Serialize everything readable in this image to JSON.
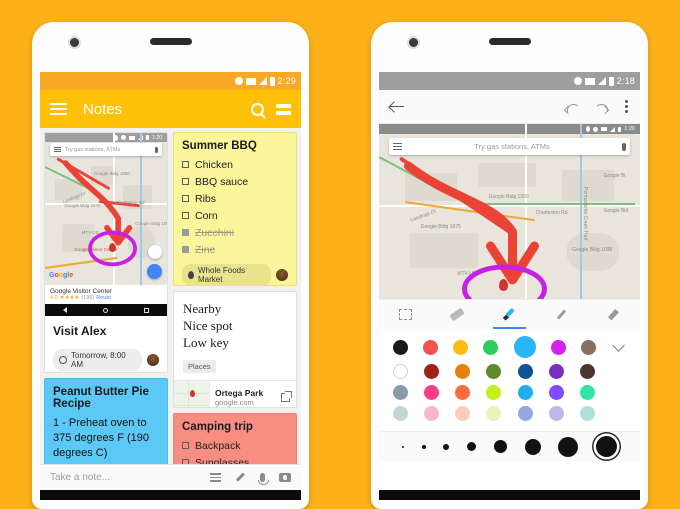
{
  "background_color": "#FBB117",
  "left_phone": {
    "status_bar": {
      "time": "2:29",
      "icons": [
        "alarm-icon",
        "wifi-icon",
        "signal-icon",
        "battery-icon"
      ],
      "background": "#F9A825"
    },
    "app_bar": {
      "title": "Notes",
      "menu_icon": "hamburger-icon",
      "search_icon": "search-icon",
      "view_toggle_icon": "list-view-icon",
      "background": "#FFC107"
    },
    "notes": {
      "map_note": {
        "search_placeholder": "Try gas stations, ATMs",
        "map_labels": [
          "Google Bldg 1950",
          "Google Bldg 1875",
          "Charleston Rd",
          "Landings Dr",
          "Google Bldg 1098",
          "MTV-US",
          "Google Visitor Center",
          "Permanente Creek Trail"
        ],
        "logo_text": "Google",
        "place_card": {
          "name": "Google Visitor Center",
          "rating": "4.0",
          "reviews": "(195)",
          "action": "Route"
        }
      },
      "visit_note": {
        "title": "Visit Alex",
        "reminder": "Tomorrow, 8:00 AM",
        "clock_icon": "clock-icon",
        "avatar": "user-avatar"
      },
      "recipe_note": {
        "title": "Peanut Butter Pie Recipe",
        "body": "1 - Preheat oven to 375 degrees F (190 degrees C)",
        "color": "#5CC8F5"
      },
      "bbq_note": {
        "title": "Summer BBQ",
        "color": "#FBF59B",
        "items": [
          {
            "label": "Chicken",
            "checked": false
          },
          {
            "label": "BBQ sauce",
            "checked": false
          },
          {
            "label": "Ribs",
            "checked": false
          },
          {
            "label": "Corn",
            "checked": false
          },
          {
            "label": "Zucchini",
            "checked": true
          },
          {
            "label": "Zinc",
            "checked": true
          }
        ],
        "chip": {
          "label": "Whole Foods Market",
          "icon": "location-pin-icon"
        },
        "collaborator": "user-avatar"
      },
      "nearby_note": {
        "lines": [
          "Nearby",
          "Nice spot",
          "Low key"
        ],
        "tag": "Places",
        "link": {
          "title": "Ortega Park",
          "url": "google.com",
          "icon": "external-link-icon"
        }
      },
      "camping_note": {
        "title": "Camping trip",
        "color": "#F78E81",
        "items": [
          {
            "label": "Backpack",
            "checked": false
          },
          {
            "label": "Sunglasses",
            "checked": false
          }
        ]
      }
    },
    "compose_bar": {
      "placeholder": "Take a note...",
      "icons": [
        "list-icon",
        "pen-icon",
        "mic-icon",
        "camera-icon"
      ]
    }
  },
  "right_phone": {
    "status_bar": {
      "time": "2:18",
      "icons": [
        "alarm-icon",
        "wifi-icon",
        "signal-icon",
        "battery-icon"
      ],
      "background": "#9e9e9e"
    },
    "draw_toolbar": {
      "back_icon": "back-arrow-icon",
      "undo_icon": "undo-icon",
      "redo_icon": "redo-icon",
      "overflow_icon": "kebab-menu-icon"
    },
    "canvas": {
      "inner_status_time": "1:20",
      "search_placeholder": "Try gas stations, ATMs",
      "map_labels": [
        "Google Bldg 1950",
        "Google Bldg 1875",
        "Charleston Rd",
        "Landings Dr",
        "Google Bldg 1098",
        "MTV-US",
        "Google Bl",
        "Google Bld",
        "Permanente Creek Trail"
      ],
      "annotation_colors": [
        "#EA4335",
        "#C820E0"
      ]
    },
    "tools": [
      {
        "name": "selection-tool",
        "icon": "selection-icon",
        "active": false
      },
      {
        "name": "eraser-tool",
        "icon": "eraser-icon",
        "active": false
      },
      {
        "name": "marker-tool",
        "icon": "marker-icon",
        "active": true
      },
      {
        "name": "pen-tool",
        "icon": "pen-icon",
        "active": false
      },
      {
        "name": "highlighter-tool",
        "icon": "highlighter-icon",
        "active": false
      }
    ],
    "palette": {
      "selected_color": "#29B6F6",
      "expand_icon": "chevron-down-icon",
      "rows": [
        [
          "#1A1A1A",
          "#F4524D",
          "#FDBA12",
          "#2ECC5B",
          "#29B6F6",
          "#D520F0",
          "#8D6E63"
        ],
        [
          "#FFFFFF",
          "#9C2116",
          "#E8800C",
          "#5D8C29",
          "#0B5394",
          "#7B2FBE",
          "#4E342E"
        ],
        [
          "#8A9BA8",
          "#FF3D8B",
          "#FF6B3D",
          "#C5F01A",
          "#1FAEF0",
          "#7C4DFF",
          "#2FE6A8"
        ],
        [
          "#C6D4D9",
          "#F7B9CA",
          "#FBCDB8",
          "#EDF2BC",
          "#97A6DF",
          "#C4B5E8",
          "#AEDFD8"
        ]
      ]
    },
    "brush_sizes": [
      2,
      4,
      6,
      9,
      13,
      16,
      20,
      25
    ],
    "selected_brush_index": 7
  }
}
